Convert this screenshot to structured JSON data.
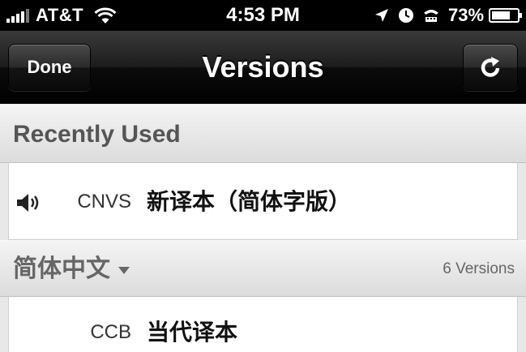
{
  "status_bar": {
    "carrier": "AT&T",
    "time": "4:53 PM",
    "battery_percent": "73",
    "battery_suffix": "%",
    "battery_level": 0.73,
    "icons": [
      "signal-bars-icon",
      "wifi-icon",
      "location-arrow-icon",
      "clock-icon",
      "tty-icon",
      "battery-icon"
    ]
  },
  "nav": {
    "title": "Versions",
    "done_label": "Done",
    "refresh_icon": "refresh-icon"
  },
  "sections": {
    "recent": {
      "title": "Recently Used",
      "items": [
        {
          "abbr": "CNVS",
          "name": "新译本（简体字版）",
          "icon": "speaker-icon"
        }
      ]
    },
    "chinese": {
      "title": "简体中文",
      "count": "6 Versions",
      "items": [
        {
          "abbr": "CCB",
          "name": "当代译本"
        }
      ]
    }
  },
  "colors": {
    "status_bar_bg": "#000000",
    "nav_bar_bg": "#1c1c1c",
    "section_header_bg": "#e0e0e0",
    "row_bg": "#ffffff"
  }
}
